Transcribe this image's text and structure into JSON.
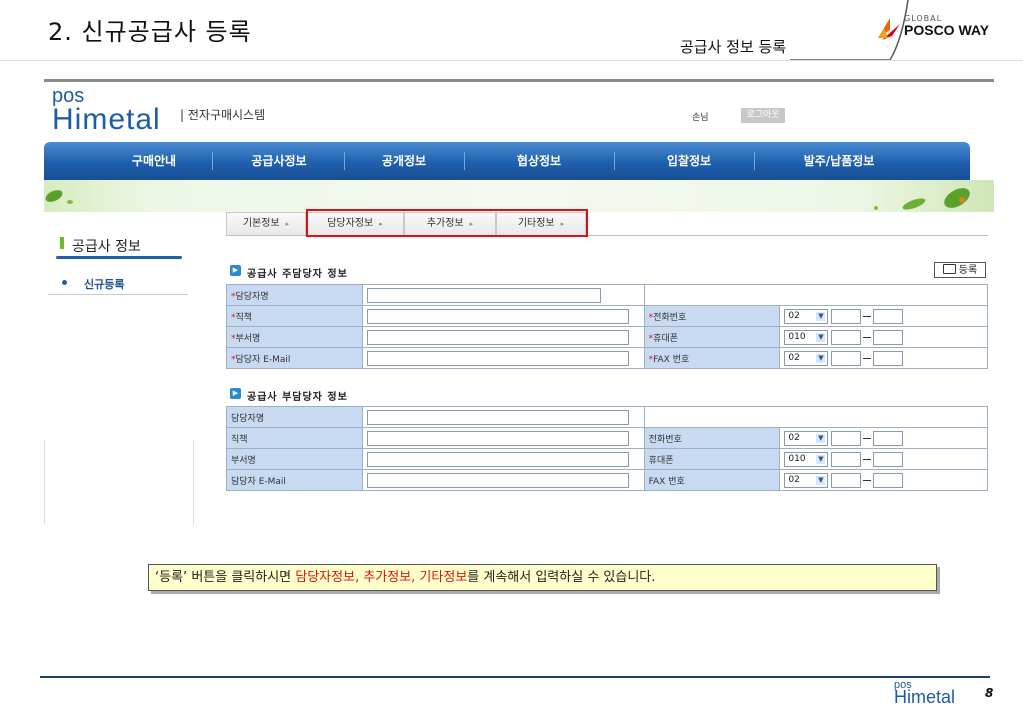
{
  "slide": {
    "title": "2. 신규공급사 등록",
    "subtitle": "공급사 정보 등록",
    "corp_logo_small": "GLOBAL",
    "corp_logo_text": "POSCO WAY",
    "page_number": "8"
  },
  "app": {
    "brand_top": "pos",
    "brand_main": "Himetal",
    "system_name": "| 전자구매시스템",
    "guest_label": "손님",
    "logout_label": "로그아웃"
  },
  "nav": [
    "구매안내",
    "공급사정보",
    "공개정보",
    "협상정보",
    "입찰정보",
    "발주/납품정보"
  ],
  "sidebar": {
    "title": "공급사 정보",
    "items": [
      "신규등록"
    ]
  },
  "tabs": [
    "기본정보",
    "담당자정보",
    "추가정보",
    "기타정보"
  ],
  "tab_arrow": "▸",
  "register_button": "등록",
  "primary": {
    "title": "공급사 주담당자 정보",
    "labels": {
      "name": "담당자명",
      "position": "직책",
      "dept": "부서명",
      "email": "담당자 E-Mail",
      "phone": "전화번호",
      "mobile": "휴대폰",
      "fax": "FAX 번호"
    },
    "required_mark": "*",
    "phone_prefix": "02",
    "mobile_prefix": "010",
    "fax_prefix": "02"
  },
  "secondary": {
    "title": "공급사 부담당자 정보",
    "labels": {
      "name": "담당자명",
      "position": "직책",
      "dept": "부서명",
      "email": "담당자 E-Mail",
      "phone": "전화번호",
      "mobile": "휴대폰",
      "fax": "FAX 번호"
    },
    "phone_prefix": "02",
    "mobile_prefix": "010",
    "fax_prefix": "02"
  },
  "note": {
    "part1": "‘등록’ 버튼을 클릭하시면 ",
    "highlight": "담당자정보, 추가정보, 기타정보",
    "part2": "를 계속해서 입력하실 수 있습니다."
  },
  "footer_logo": {
    "top": "pos",
    "main": "Himetal"
  }
}
